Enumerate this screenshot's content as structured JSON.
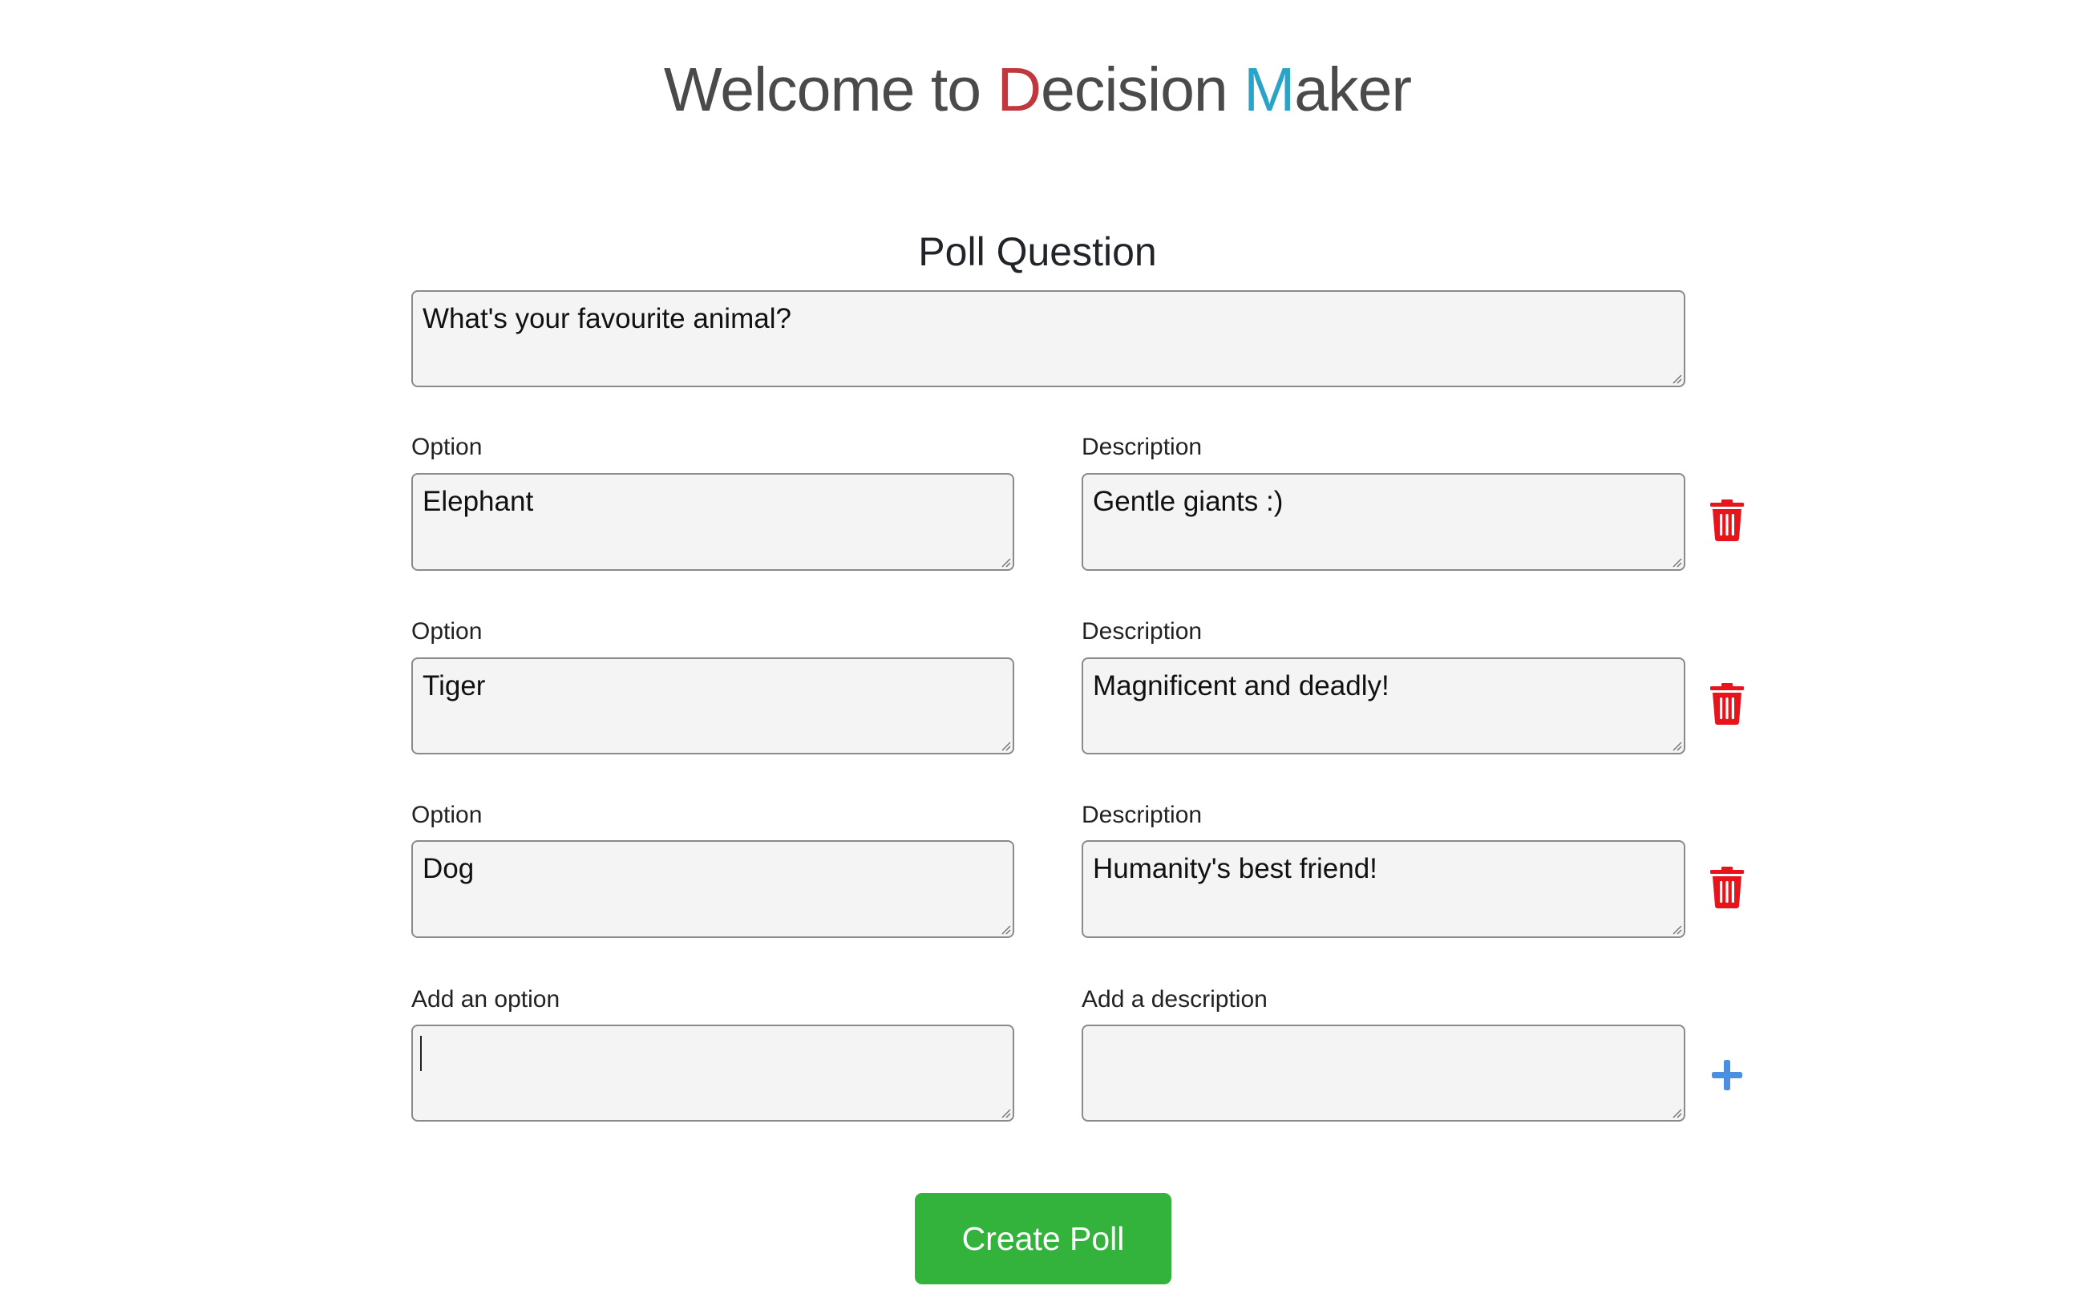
{
  "header": {
    "title_prefix": "Welcome to ",
    "title_d": "D",
    "title_ecision": "ecision ",
    "title_m": "M",
    "title_aker": "aker"
  },
  "poll": {
    "heading": "Poll Question",
    "question_value": "What's your favourite animal?"
  },
  "options": [
    {
      "option_label": "Option",
      "option_value": "Elephant",
      "description_label": "Description",
      "description_value": "Gentle giants :)"
    },
    {
      "option_label": "Option",
      "option_value": "Tiger",
      "description_label": "Description",
      "description_value": "Magnificent and deadly!"
    },
    {
      "option_label": "Option",
      "option_value": "Dog",
      "description_label": "Description",
      "description_value": "Humanity's best friend!"
    }
  ],
  "new_option": {
    "option_label": "Add an option",
    "option_value": "",
    "description_label": "Add a description",
    "description_value": ""
  },
  "actions": {
    "create_label": "Create Poll"
  },
  "icons": {
    "delete": "trash-icon",
    "add": "plus-icon"
  },
  "colors": {
    "title": "#4a4a4a",
    "title_d": "#c0383e",
    "title_m": "#2aa3c9",
    "delete_icon": "#e8141c",
    "add_icon": "#4a8fe0",
    "create_button": "#33b33b"
  }
}
